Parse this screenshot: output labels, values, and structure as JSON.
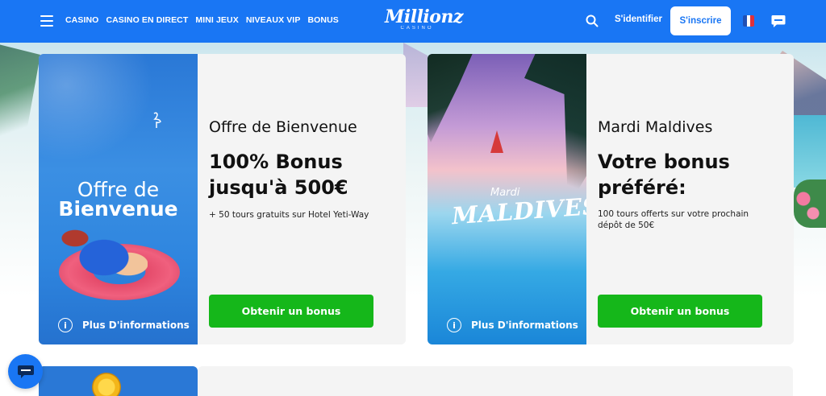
{
  "nav": {
    "links": [
      "CASINO",
      "CASINO EN DIRECT",
      "MINI JEUX",
      "NIVEAUX VIP",
      "BONUS"
    ],
    "logo": "Millionz",
    "logo_sub": "CASINO",
    "signin": "S'identifier",
    "signup": "S'inscrire"
  },
  "cards": [
    {
      "image_title_line1": "Offre de",
      "image_title_line2": "Bienvenue",
      "subtitle": "Offre de Bienvenue",
      "title_line1": "100% Bonus",
      "title_line2": "jusqu'à 500€",
      "description": "+ 50 tours gratuits sur Hotel Yeti-Way",
      "button": "Obtenir un bonus",
      "more_info": "Plus D'informations"
    },
    {
      "image_title_line1": "Mardi",
      "image_title_line2": "MALDIVES",
      "subtitle": "Mardi Maldives",
      "title_line1": "Votre bonus",
      "title_line2": "préféré:",
      "description": "100 tours offerts sur votre prochain dépôt de 50€",
      "button": "Obtenir un bonus",
      "more_info": "Plus D'informations"
    }
  ],
  "colors": {
    "primary_blue": "#1976f4",
    "button_green": "#15b71a",
    "card_bg": "#f4f4f4"
  },
  "icons": [
    "menu-icon",
    "search-icon",
    "flag-icon",
    "chat-icon",
    "info-icon",
    "support-chat-icon"
  ]
}
